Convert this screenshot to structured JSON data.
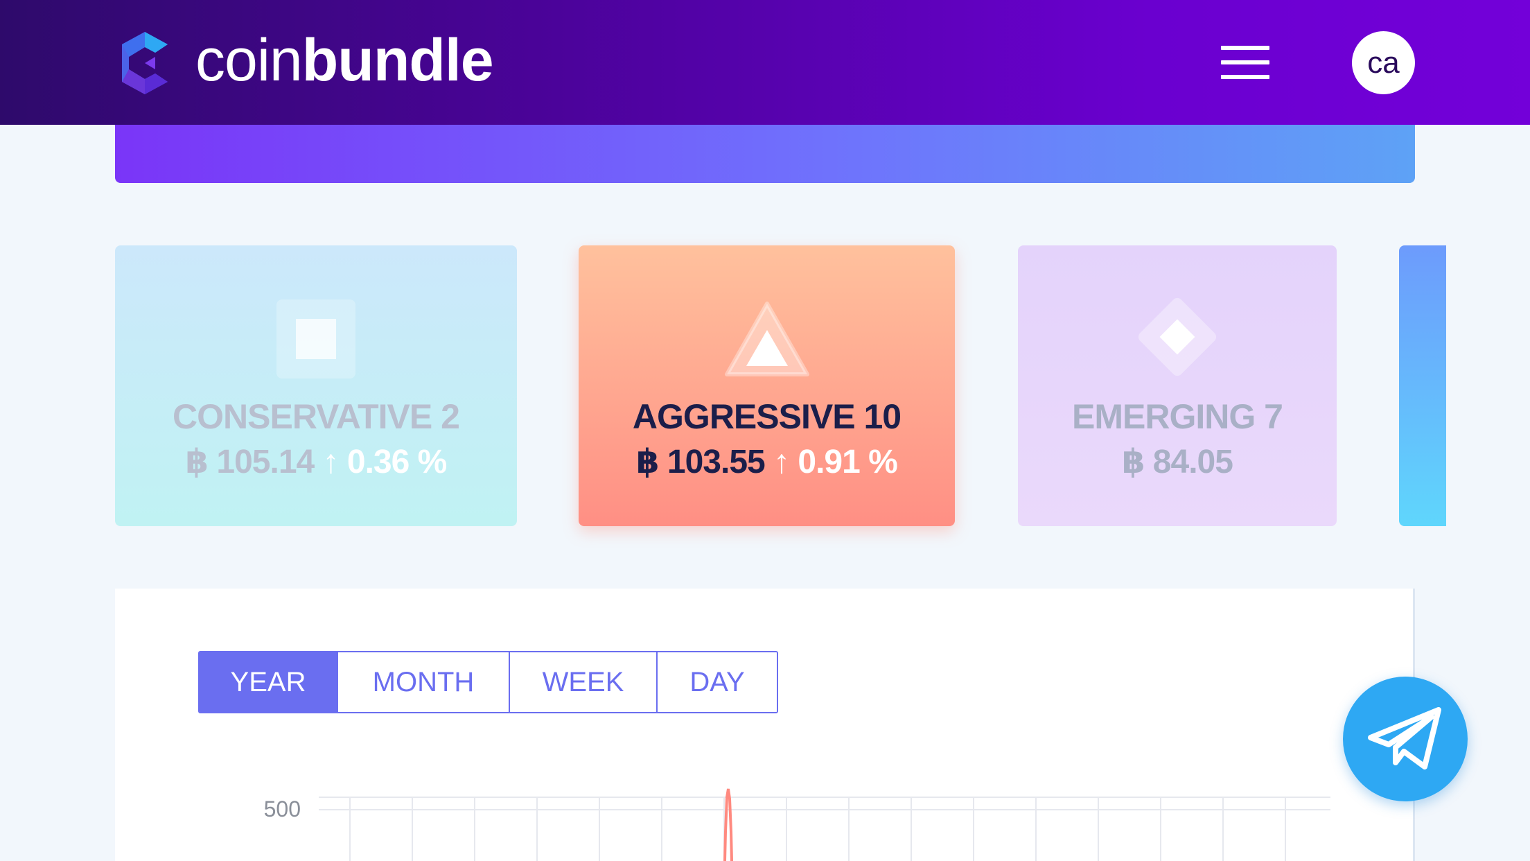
{
  "header": {
    "brand_light": "coin",
    "brand_bold": "bundle",
    "avatar_initials": "ca"
  },
  "bundles": [
    {
      "name": "CONSERVATIVE 2",
      "price": "฿ 105.14",
      "change": "↑ 0.36 %",
      "icon": "square-icon",
      "selected": false
    },
    {
      "name": "AGGRESSIVE 10",
      "price": "฿ 103.55",
      "change": "↑ 0.91 %",
      "icon": "triangle-icon",
      "selected": true
    },
    {
      "name": "EMERGING 7",
      "price": "฿ 84.05",
      "change": "",
      "icon": "diamond-icon",
      "selected": false
    }
  ],
  "chart_controls": {
    "tabs": [
      "YEAR",
      "MONTH",
      "WEEK",
      "DAY"
    ],
    "active": "YEAR"
  },
  "chart_data": {
    "type": "line",
    "yticks": [
      "500"
    ],
    "colors": {
      "line": "#ff8a80",
      "grid": "#e6e8ee"
    }
  },
  "colors": {
    "accent": "#6a6ef0",
    "header_start": "#2e0a6b",
    "header_end": "#7300d9",
    "telegram": "#2ea8f3"
  }
}
